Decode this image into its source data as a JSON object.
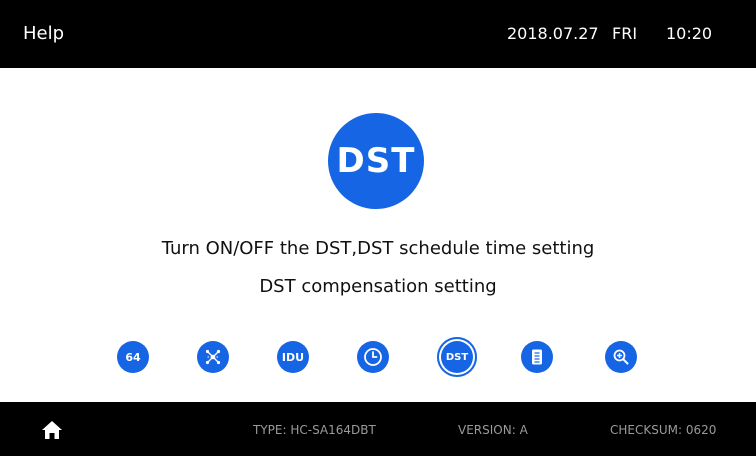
{
  "header": {
    "title": "Help",
    "date": "2018.07.27",
    "weekday": "FRI",
    "time": "10:20"
  },
  "main": {
    "icon_text": "DST",
    "description_line1": "Turn ON/OFF the DST,DST schedule time setting",
    "description_line2": "DST compensation setting"
  },
  "nav": {
    "items": [
      {
        "label": "64",
        "icon": "address-64-icon"
      },
      {
        "label": "",
        "icon": "network-icon"
      },
      {
        "label": "IDU",
        "icon": "idu-icon"
      },
      {
        "label": "",
        "icon": "clock-icon"
      },
      {
        "label": "DST",
        "icon": "dst-icon",
        "active": true
      },
      {
        "label": "",
        "icon": "document-icon"
      },
      {
        "label": "",
        "icon": "zoom-in-icon"
      }
    ]
  },
  "footer": {
    "type": "TYPE: HC-SA164DBT",
    "version": "VERSION: A",
    "checksum": "CHECKSUM: 0620"
  },
  "colors": {
    "accent": "#1565e4",
    "bar": "#000000",
    "footer_text": "#9a9a9a"
  }
}
